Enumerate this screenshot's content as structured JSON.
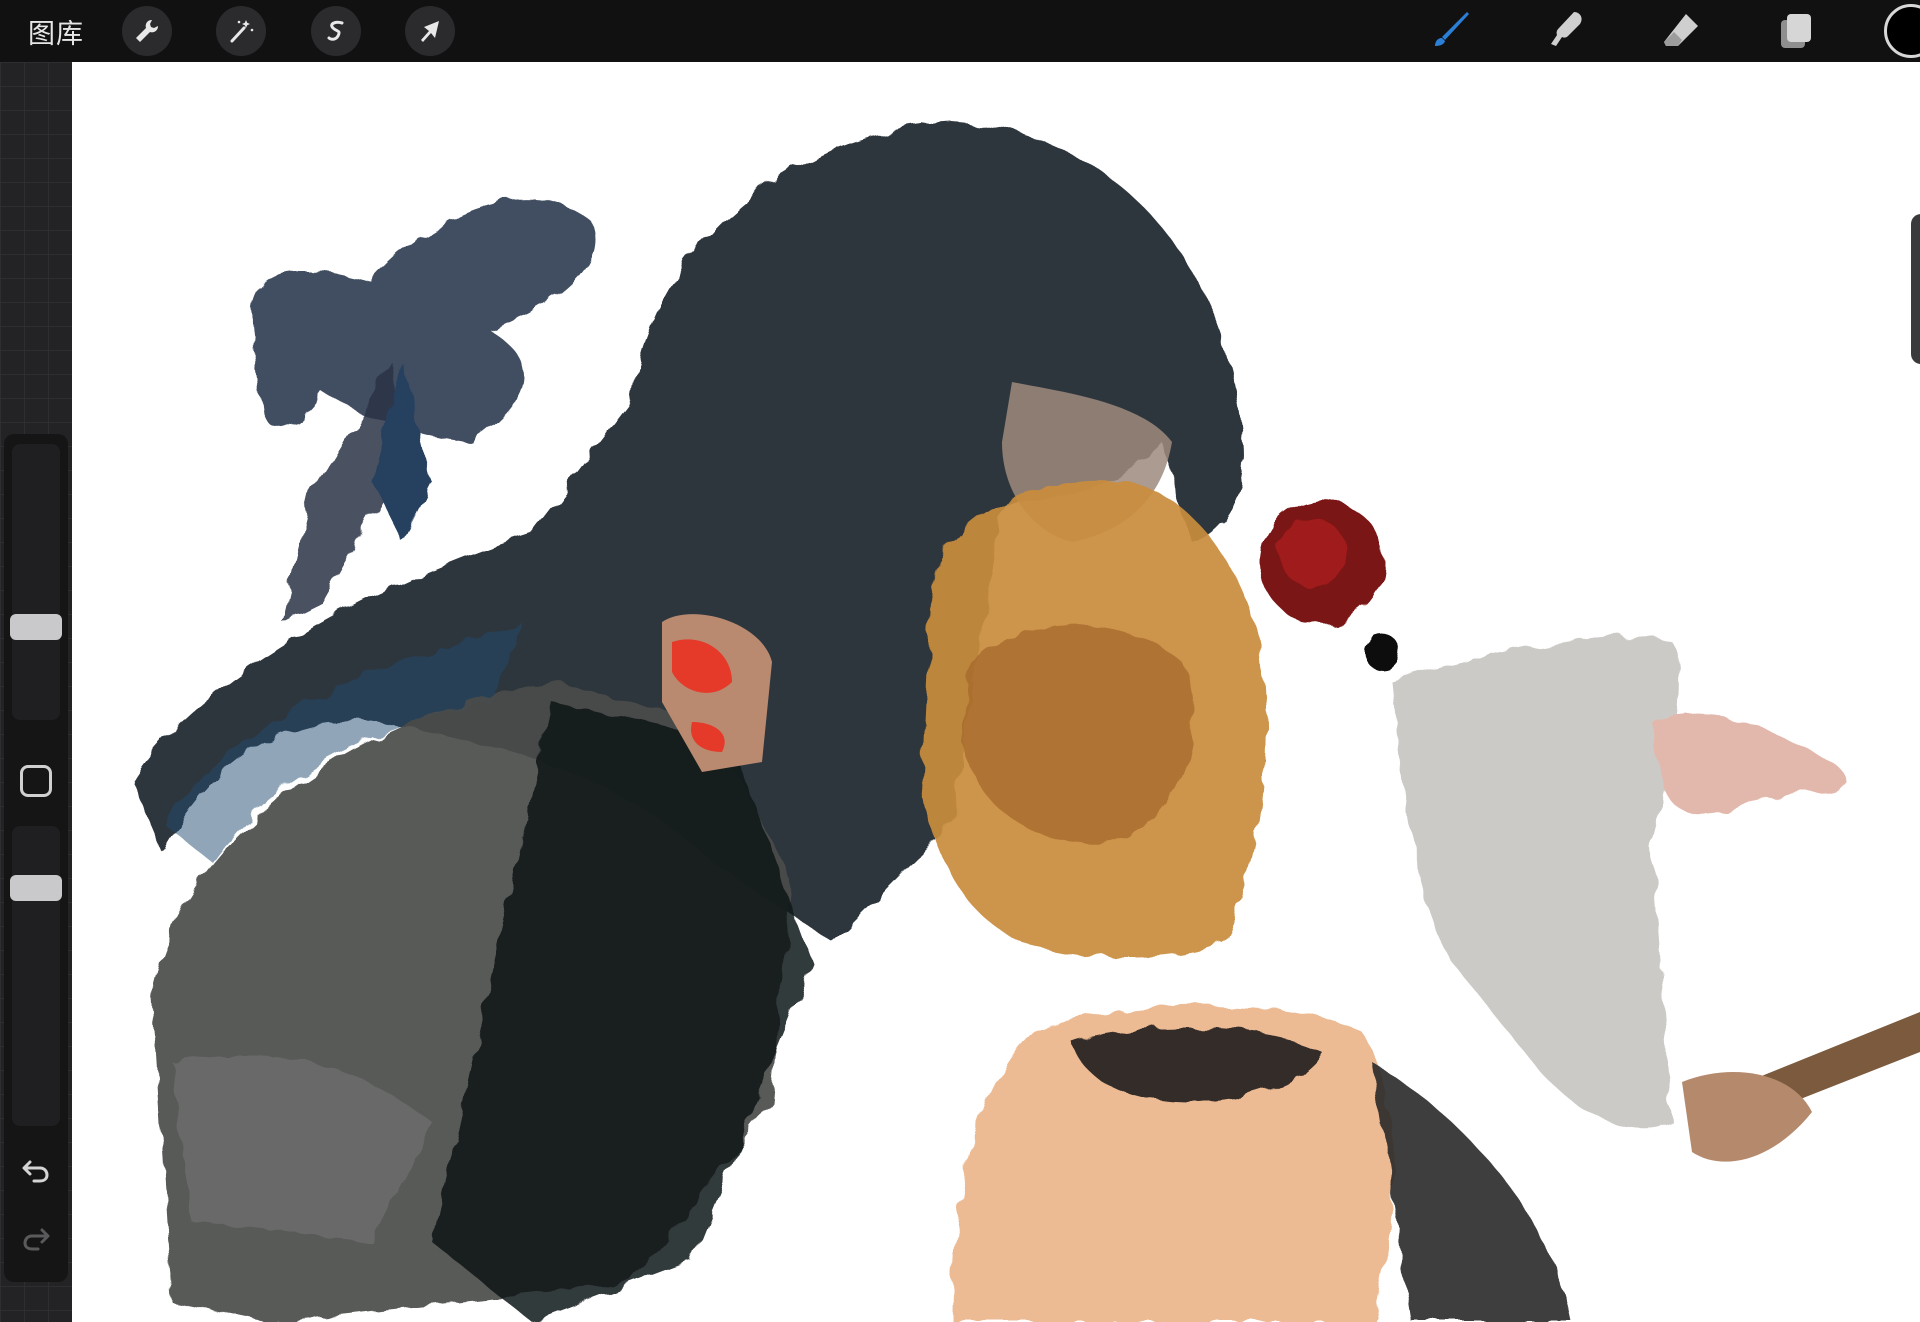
{
  "topbar": {
    "gallery_label": "图库",
    "left_tools": [
      {
        "name": "actions",
        "icon": "wrench-icon"
      },
      {
        "name": "adjustments",
        "icon": "magic-wand-icon"
      },
      {
        "name": "selection",
        "icon": "selection-s-icon"
      },
      {
        "name": "transform",
        "icon": "arrow-cursor-icon"
      }
    ],
    "right_tools": [
      {
        "name": "brush",
        "icon": "brush-icon",
        "active": true
      },
      {
        "name": "smudge",
        "icon": "smudge-finger-icon",
        "active": false
      },
      {
        "name": "eraser",
        "icon": "eraser-icon",
        "active": false
      },
      {
        "name": "layers",
        "icon": "layers-icon",
        "active": false
      }
    ],
    "current_color": "#000000",
    "active_color": "#2b7fd6"
  },
  "sidebar": {
    "brush_size_level": 0.32,
    "opacity_level": 0.82,
    "modify_icon": "square-icon",
    "undo_icon": "undo-arrow-icon",
    "redo_icon": "redo-arrow-icon"
  },
  "canvas": {
    "background": "#ffffff",
    "artwork": "illustration-of-two-figures"
  }
}
